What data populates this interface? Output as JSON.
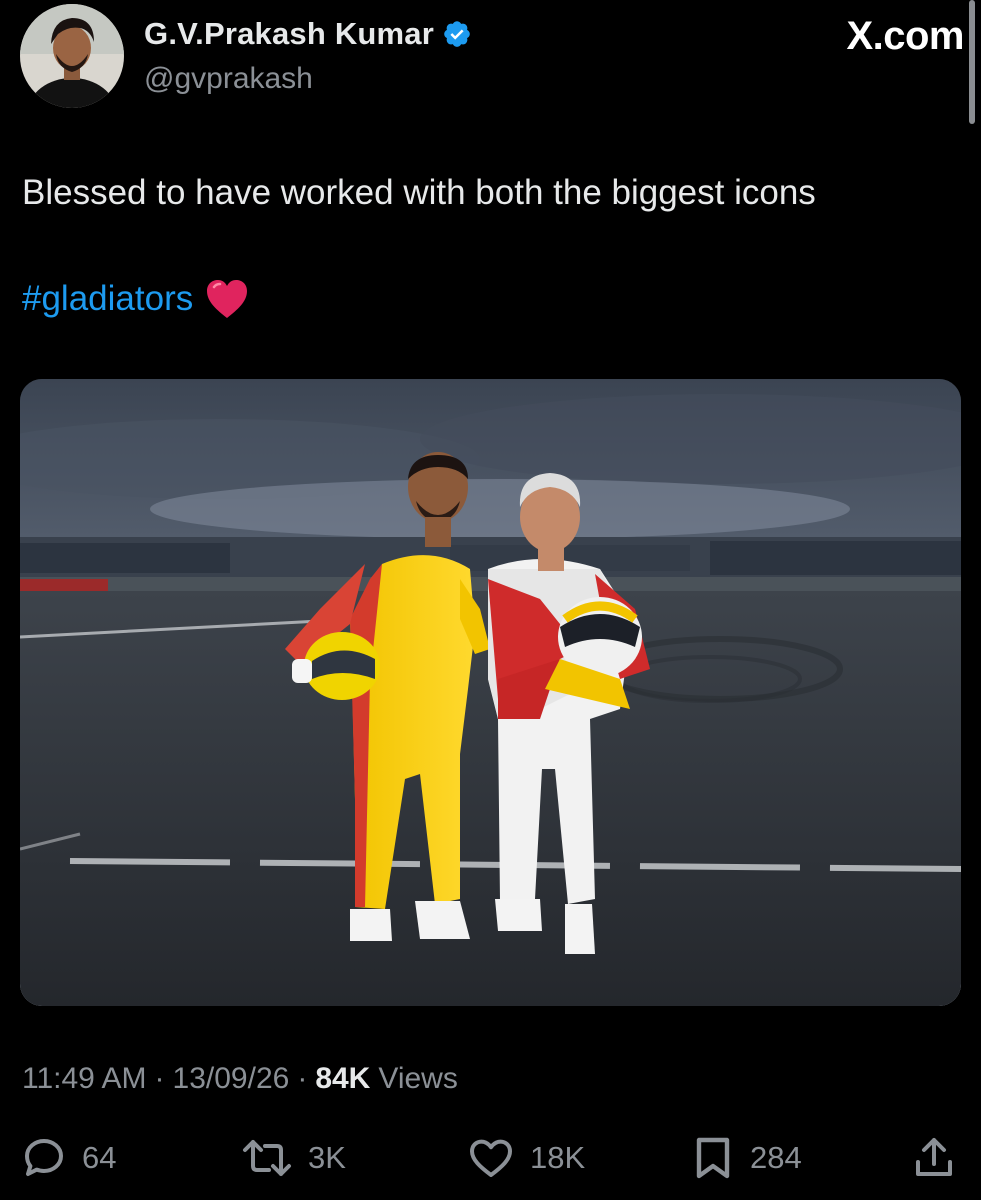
{
  "author": {
    "display_name": "G.V.Prakash Kumar",
    "handle": "@gvprakash",
    "verified": true
  },
  "site_label": "X.com",
  "tweet": {
    "text": "Blessed to have worked with both the biggest icons",
    "hashtag": "#gladiators",
    "emoji": "heart-emoji"
  },
  "meta": {
    "time": "11:49 AM",
    "date": "13/09/26",
    "views_count": "84K",
    "views_label": "Views",
    "separator": "·"
  },
  "actions": {
    "replies": "64",
    "reposts": "3K",
    "likes": "18K",
    "bookmarks": "284"
  },
  "colors": {
    "background": "#000000",
    "link": "#1d9bf0",
    "verified": "#1d9bf0",
    "muted": "#8b9096",
    "heart": "#e0245e"
  },
  "media": {
    "description_icon": "photo-two-racers-track"
  }
}
